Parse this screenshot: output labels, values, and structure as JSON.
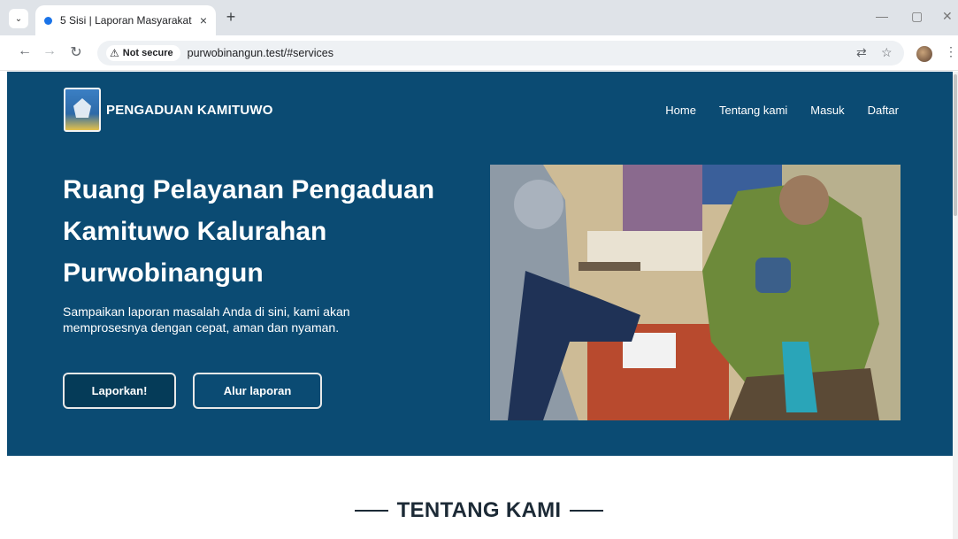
{
  "browser": {
    "tab_title": "5 Sisi | Laporan Masyarakat",
    "tab_close": "×",
    "new_tab": "+",
    "security_label": "Not secure",
    "url": "purwobinangun.test/#services",
    "icons": [
      "tab-list-icon",
      "back-icon",
      "forward-icon",
      "reload-icon",
      "warning-icon",
      "translate-icon",
      "bookmark-star-icon",
      "profile-avatar",
      "more-menu-icon",
      "minimize-icon",
      "restore-icon",
      "close-window-icon"
    ]
  },
  "header": {
    "brand": "PENGADUAN KAMITUWO",
    "nav": [
      "Home",
      "Tentang kami",
      "Masuk",
      "Daftar"
    ]
  },
  "hero": {
    "headline_line1": "Ruang Pelayanan Pengaduan",
    "headline_line2": "Kamituwo Kalurahan",
    "headline_line3": "Purwobinangun",
    "subtext_line1": "Sampaikan laporan masalah Anda di sini, kami akan",
    "subtext_line2": "memprosesnya dengan cepat, aman dan nyaman.",
    "primary_button": "Laporkan!",
    "secondary_button": "Alur laporan"
  },
  "section": {
    "title": "TENTANG KAMI"
  },
  "colors": {
    "hero_bg": "#0b4b73",
    "button_dark": "#053b58",
    "heading_dark": "#1c2a36"
  }
}
